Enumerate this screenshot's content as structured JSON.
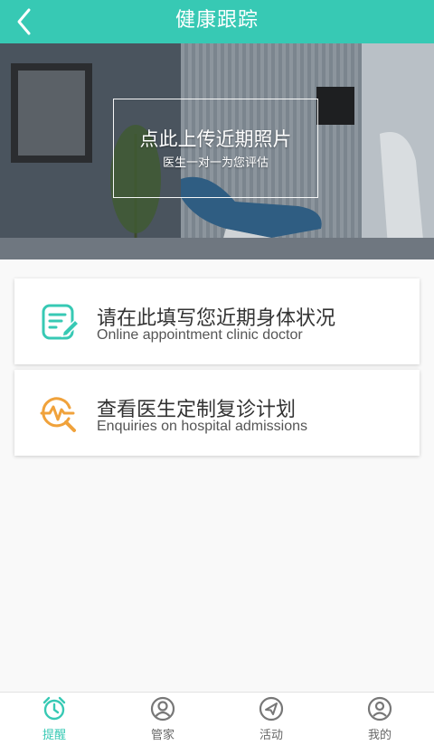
{
  "header": {
    "title": "健康跟踪",
    "back_icon": "chevron-left-icon"
  },
  "banner": {
    "upload_title": "点此上传近期照片",
    "upload_subtitle": "医生一对一为您评估"
  },
  "cards": [
    {
      "icon": "edit-document-icon",
      "icon_color": "#37c9b4",
      "title": "请在此填写您近期身体状况",
      "subtitle": "Online appointment clinic doctor"
    },
    {
      "icon": "search-pulse-icon",
      "icon_color": "#f0a23b",
      "title": "查看医生定制复诊计划",
      "subtitle": "Enquiries on hospital admissions"
    }
  ],
  "tabbar": {
    "active_color": "#37c9b4",
    "items": [
      {
        "label": "提醒",
        "icon": "alarm-clock-icon",
        "active": true
      },
      {
        "label": "管家",
        "icon": "person-circle-icon",
        "active": false
      },
      {
        "label": "活动",
        "icon": "paper-plane-icon",
        "active": false
      },
      {
        "label": "我的",
        "icon": "user-circle-icon",
        "active": false
      }
    ]
  }
}
